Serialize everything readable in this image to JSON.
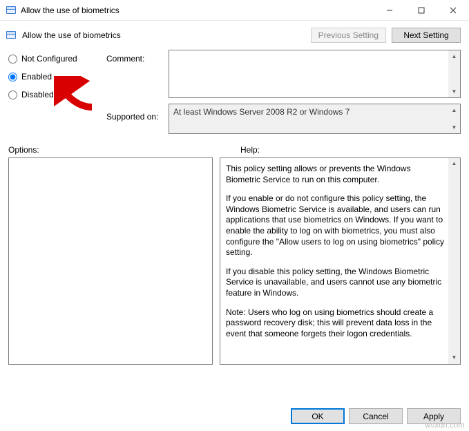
{
  "window": {
    "title": "Allow the use of biometrics"
  },
  "header": {
    "page_title": "Allow the use of biometrics",
    "previous_setting": "Previous Setting",
    "next_setting": "Next Setting"
  },
  "radios": {
    "not_configured": "Not Configured",
    "enabled": "Enabled",
    "disabled": "Disabled",
    "selected": "enabled"
  },
  "labels": {
    "comment": "Comment:",
    "supported_on": "Supported on:",
    "options": "Options:",
    "help": "Help:"
  },
  "fields": {
    "comment_value": "",
    "supported_on_value": "At least Windows Server 2008 R2 or Windows 7"
  },
  "help": {
    "p1": "This policy setting allows or prevents the Windows Biometric Service to run on this computer.",
    "p2": "If you enable or do not configure this policy setting, the Windows Biometric Service is available, and users can run applications that use biometrics on Windows. If you want to enable the ability to log on with biometrics, you must also configure the \"Allow users to log on using biometrics\" policy setting.",
    "p3": "If you disable this policy setting, the Windows Biometric Service is unavailable, and users cannot use any biometric feature in Windows.",
    "p4": "Note: Users who log on using biometrics should create a password recovery disk; this will prevent data loss in the event that someone forgets their logon credentials."
  },
  "footer": {
    "ok": "OK",
    "cancel": "Cancel",
    "apply": "Apply"
  },
  "watermark": "wsxdn.com",
  "annotation": {
    "arrow_target": "enabled-radio"
  }
}
